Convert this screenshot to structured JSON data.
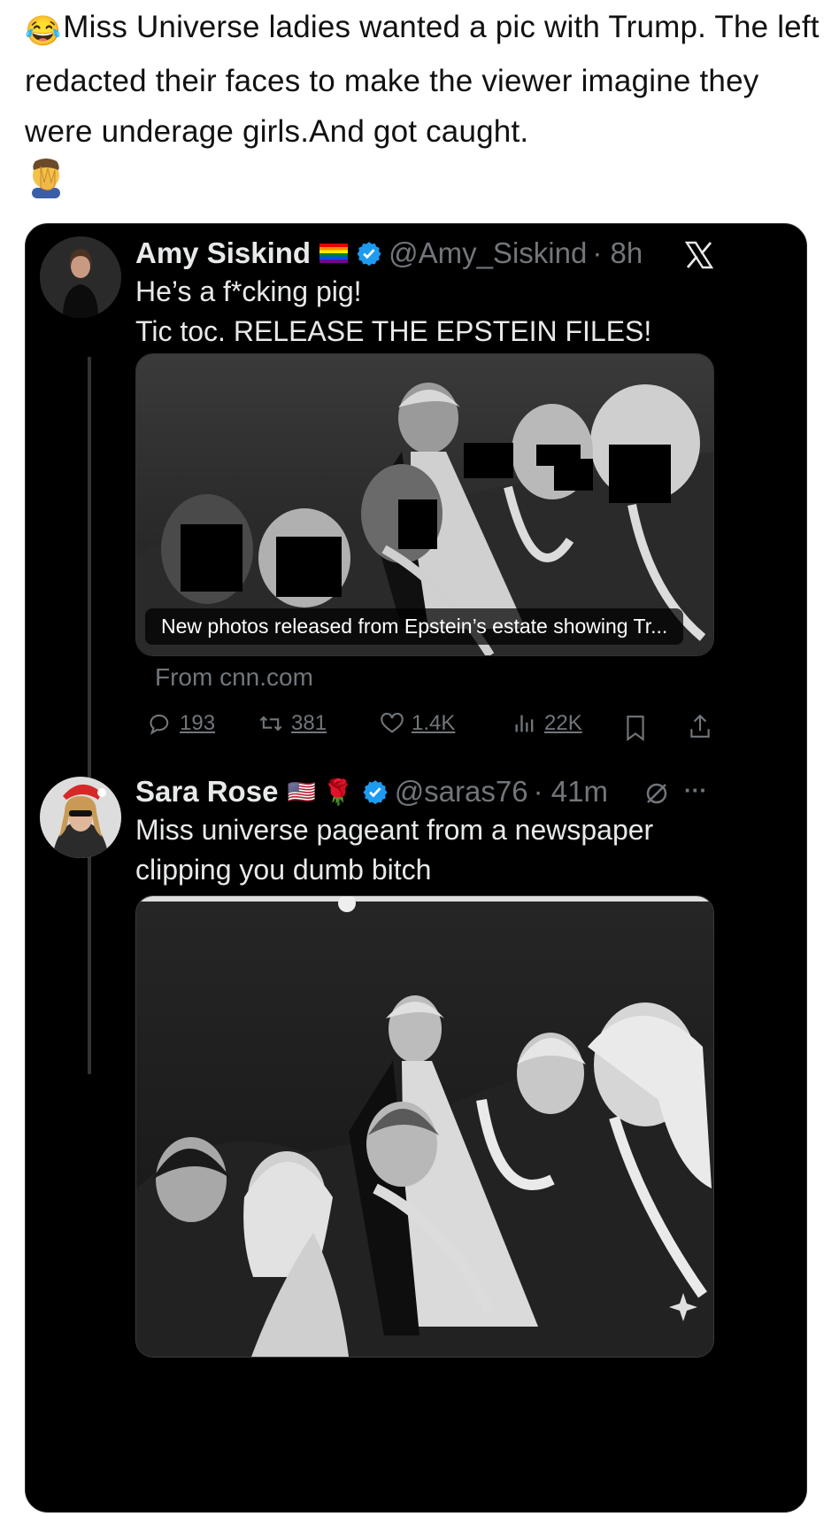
{
  "caption": {
    "emoji": "😂",
    "text": "Miss Universe ladies wanted a pic with Trump. The left redacted their faces to make the viewer imagine they were underage girls.And got caught.",
    "end_emoji": "🤦‍♂️"
  },
  "tweet1": {
    "name": "Amy Siskind",
    "flag": "rainbow-flag",
    "handle": "@Amy_Siskind",
    "time": "· 8h",
    "line1": "He’s a f*cking pig!",
    "line2": "Tic toc. RELEASE THE EPSTEIN FILES!",
    "media_caption": "New photos released from Epstein’s estate showing Tr...",
    "source": "From cnn.com",
    "actions": {
      "replies": "193",
      "reposts": "381",
      "likes": "1.4K",
      "views": "22K"
    }
  },
  "tweet2": {
    "name": "Sara Rose",
    "flag": "🇺🇸",
    "rose": "🌹",
    "handle": "@saras76",
    "time": "· 41m",
    "text": "Miss universe pageant from a newspaper clipping you dumb bitch",
    "more": "···"
  },
  "colors": {
    "card_bg": "#000000",
    "text": "#e7e9ea",
    "muted": "#71767b",
    "verified": "#1d9bf0"
  }
}
